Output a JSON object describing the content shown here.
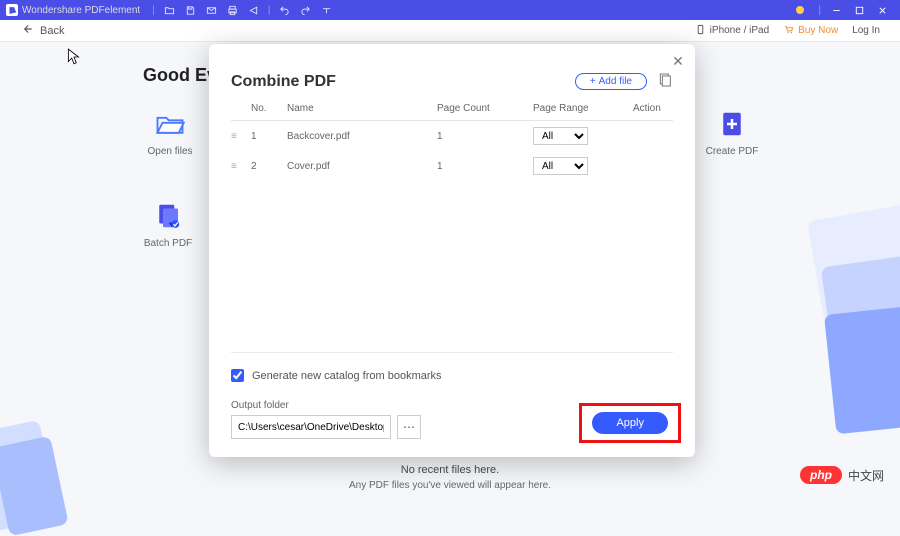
{
  "app": {
    "title": "Wondershare PDFelement",
    "back_label": "Back",
    "right_menu": {
      "iphone": "iPhone / iPad",
      "buy": "Buy Now",
      "login": "Log In"
    }
  },
  "greeting": "Good Evening",
  "tiles": {
    "open": "Open files",
    "create": "Create PDF",
    "batch": "Batch PDF"
  },
  "dialog": {
    "title": "Combine PDF",
    "add_file": "Add file",
    "columns": {
      "no": "No.",
      "name": "Name",
      "page_count": "Page Count",
      "page_range": "Page Range",
      "action": "Action"
    },
    "rows": [
      {
        "no": "1",
        "name": "Backcover.pdf",
        "page_count": "1",
        "range": "All"
      },
      {
        "no": "2",
        "name": "Cover.pdf",
        "page_count": "1",
        "range": "All"
      }
    ],
    "gen_catalog": "Generate new catalog from bookmarks",
    "gen_catalog_checked": true,
    "output_label": "Output folder",
    "output_value": "C:\\Users\\cesar\\OneDrive\\Desktop\\PDFelem",
    "apply": "Apply"
  },
  "bottom": {
    "line1": "No recent files here.",
    "line2": "Any PDF files you've viewed will appear here."
  },
  "badge": {
    "pill": "php",
    "text": "中文网"
  }
}
